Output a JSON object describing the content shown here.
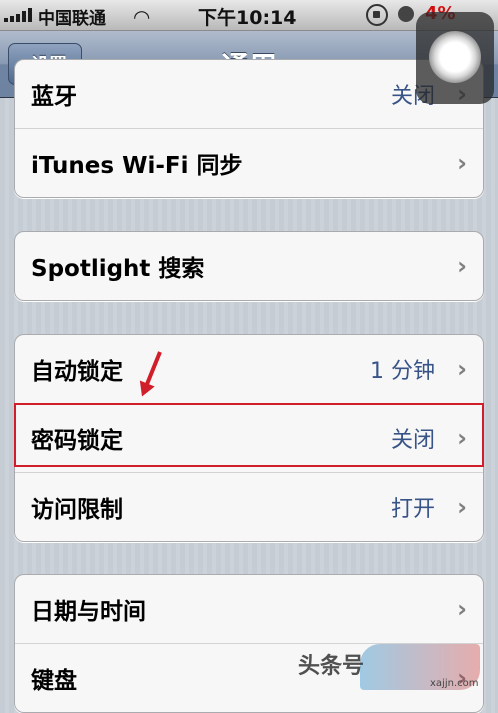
{
  "status_bar": {
    "carrier": "中国联通",
    "time": "下午10:14",
    "battery": "4%"
  },
  "nav": {
    "back_label": "设置",
    "title": "通用"
  },
  "groups": [
    {
      "rows": [
        {
          "label": "蓝牙",
          "value": "关闭"
        },
        {
          "label": "iTunes Wi-Fi 同步",
          "value": ""
        }
      ]
    },
    {
      "rows": [
        {
          "label": "Spotlight 搜索",
          "value": ""
        }
      ]
    },
    {
      "rows": [
        {
          "label": "自动锁定",
          "value": "1 分钟"
        },
        {
          "label": "密码锁定",
          "value": "关闭"
        },
        {
          "label": "访问限制",
          "value": "打开"
        }
      ]
    },
    {
      "rows": [
        {
          "label": "日期与时间",
          "value": ""
        },
        {
          "label": "键盘",
          "value": ""
        }
      ]
    }
  ],
  "chevron": "›",
  "watermark": {
    "text": "头条号",
    "site": "xajjn.com"
  },
  "colors": {
    "highlight": "#d01f2a",
    "value_text": "#385487"
  }
}
